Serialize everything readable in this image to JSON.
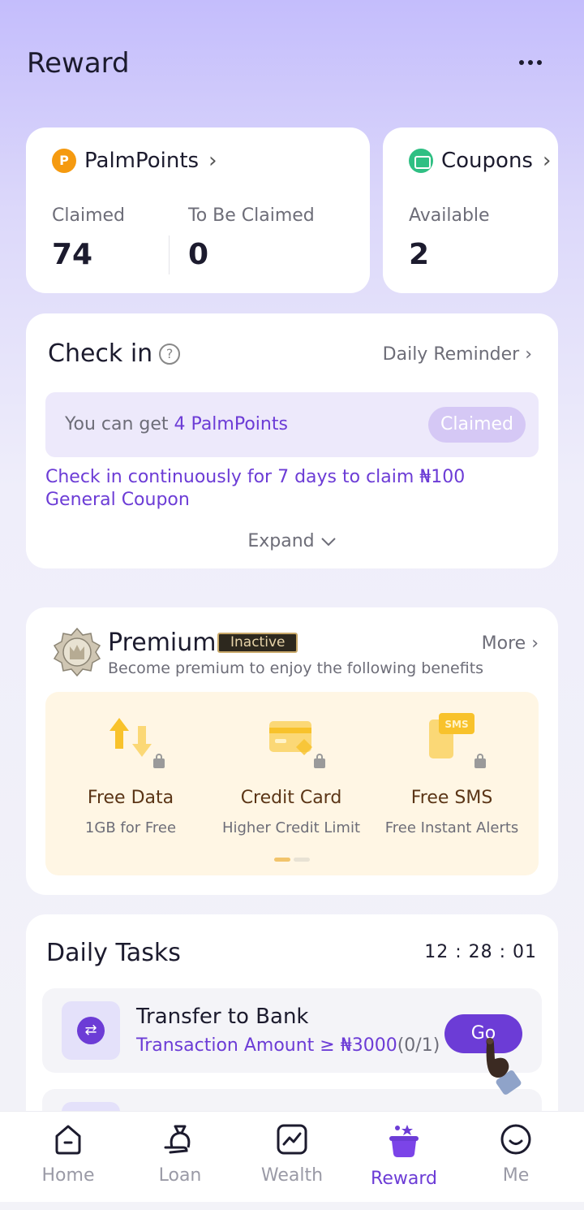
{
  "header": {
    "title": "Reward",
    "more_icon": "more-dots-icon"
  },
  "palm_points": {
    "title": "PalmPoints",
    "claimed_label": "Claimed",
    "claimed_value": "74",
    "to_be_claimed_label": "To Be Claimed",
    "to_be_claimed_value": "0"
  },
  "coupons": {
    "title": "Coupons",
    "available_label": "Available",
    "available_value": "2"
  },
  "check_in": {
    "title": "Check in",
    "daily_reminder": "Daily Reminder",
    "box_text": "You can get ",
    "box_points": "4 PalmPoints",
    "claimed_button": "Claimed",
    "note": "Check in continuously for 7 days to claim ₦100 General Coupon",
    "expand": "Expand"
  },
  "premium": {
    "title": "Premium",
    "status": "Inactive",
    "subtitle": "Become premium to enjoy the following benefits",
    "more": "More",
    "benefits": [
      {
        "name": "Free Data",
        "desc": "1GB for Free",
        "icon": "data-arrows-icon"
      },
      {
        "name": "Credit Card",
        "desc": "Higher Credit Limit",
        "icon": "credit-card-icon"
      },
      {
        "name": "Free SMS",
        "desc": "Free Instant Alerts",
        "icon": "sms-icon"
      }
    ],
    "page_indicator": {
      "active": 1,
      "total": 2,
      "active_color": "#f2c46b",
      "inactive_color": "#e8e2d4"
    }
  },
  "daily_tasks": {
    "title": "Daily Tasks",
    "timer": "12 : 28 : 01",
    "tasks": [
      {
        "name": "Transfer to Bank",
        "requirement": "Transaction Amount ≥ ₦3000",
        "progress": "(0/1)",
        "button": "Go"
      }
    ]
  },
  "bottom_nav": {
    "items": [
      {
        "label": "Home",
        "icon": "home-icon",
        "active": false
      },
      {
        "label": "Loan",
        "icon": "loan-bag-icon",
        "active": false
      },
      {
        "label": "Wealth",
        "icon": "wealth-chart-icon",
        "active": false
      },
      {
        "label": "Reward",
        "icon": "reward-pot-icon",
        "active": true
      },
      {
        "label": "Me",
        "icon": "me-smile-icon",
        "active": false
      }
    ]
  },
  "colors": {
    "accent": "#6c3cd6",
    "points": "#f59a10",
    "coupons": "#2fbf83"
  }
}
